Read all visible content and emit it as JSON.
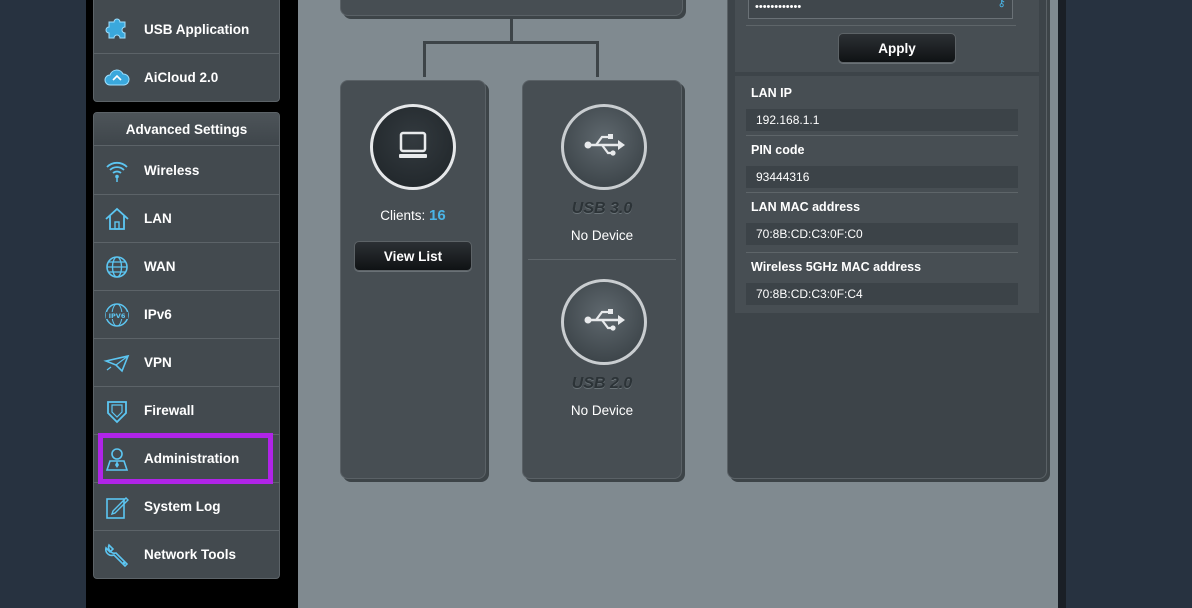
{
  "sidebar": {
    "top_items": [
      {
        "label": "USB Application",
        "icon": "puzzle-icon"
      },
      {
        "label": "AiCloud 2.0",
        "icon": "cloud-icon"
      }
    ],
    "advanced_header": "Advanced Settings",
    "advanced_items": [
      {
        "label": "Wireless",
        "icon": "wifi-icon"
      },
      {
        "label": "LAN",
        "icon": "home-icon"
      },
      {
        "label": "WAN",
        "icon": "globe-icon"
      },
      {
        "label": "IPv6",
        "icon": "ipv6-icon"
      },
      {
        "label": "VPN",
        "icon": "vpn-icon"
      },
      {
        "label": "Firewall",
        "icon": "shield-icon"
      },
      {
        "label": "Administration",
        "icon": "user-icon"
      },
      {
        "label": "System Log",
        "icon": "log-icon"
      },
      {
        "label": "Network Tools",
        "icon": "wrench-icon"
      }
    ],
    "highlighted_item": "Administration",
    "highlight_color": "#b024e8"
  },
  "clients": {
    "label": "Clients:",
    "count": "16",
    "count_color": "#4ab4e6",
    "view_list_label": "View List",
    "icon": "monitor-icon"
  },
  "usb": [
    {
      "port": "USB 3.0",
      "status": "No Device",
      "icon": "usb-icon"
    },
    {
      "port": "USB 2.0",
      "status": "No Device",
      "icon": "usb-icon"
    }
  ],
  "security": {
    "password_masked": "••••••••••••",
    "apply_label": "Apply"
  },
  "system_info": [
    {
      "label": "LAN IP",
      "value": "192.168.1.1"
    },
    {
      "label": "PIN code",
      "value": "93444316"
    },
    {
      "label": "LAN MAC address",
      "value": "70:8B:CD:C3:0F:C0"
    },
    {
      "label": "Wireless 5GHz MAC address",
      "value": "70:8B:CD:C3:0F:C4"
    }
  ]
}
